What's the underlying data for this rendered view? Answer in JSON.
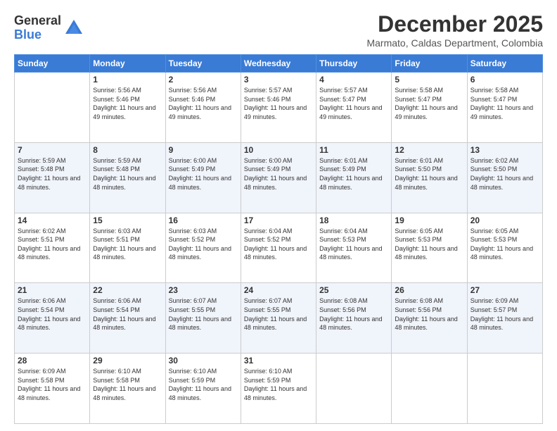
{
  "logo": {
    "general": "General",
    "blue": "Blue"
  },
  "title": "December 2025",
  "subtitle": "Marmato, Caldas Department, Colombia",
  "days_of_week": [
    "Sunday",
    "Monday",
    "Tuesday",
    "Wednesday",
    "Thursday",
    "Friday",
    "Saturday"
  ],
  "weeks": [
    [
      {
        "day": "",
        "sunrise": "",
        "sunset": "",
        "daylight": "",
        "empty": true
      },
      {
        "day": "1",
        "sunrise": "Sunrise: 5:56 AM",
        "sunset": "Sunset: 5:46 PM",
        "daylight": "Daylight: 11 hours and 49 minutes."
      },
      {
        "day": "2",
        "sunrise": "Sunrise: 5:56 AM",
        "sunset": "Sunset: 5:46 PM",
        "daylight": "Daylight: 11 hours and 49 minutes."
      },
      {
        "day": "3",
        "sunrise": "Sunrise: 5:57 AM",
        "sunset": "Sunset: 5:46 PM",
        "daylight": "Daylight: 11 hours and 49 minutes."
      },
      {
        "day": "4",
        "sunrise": "Sunrise: 5:57 AM",
        "sunset": "Sunset: 5:47 PM",
        "daylight": "Daylight: 11 hours and 49 minutes."
      },
      {
        "day": "5",
        "sunrise": "Sunrise: 5:58 AM",
        "sunset": "Sunset: 5:47 PM",
        "daylight": "Daylight: 11 hours and 49 minutes."
      },
      {
        "day": "6",
        "sunrise": "Sunrise: 5:58 AM",
        "sunset": "Sunset: 5:47 PM",
        "daylight": "Daylight: 11 hours and 49 minutes."
      }
    ],
    [
      {
        "day": "7",
        "sunrise": "Sunrise: 5:59 AM",
        "sunset": "Sunset: 5:48 PM",
        "daylight": "Daylight: 11 hours and 48 minutes."
      },
      {
        "day": "8",
        "sunrise": "Sunrise: 5:59 AM",
        "sunset": "Sunset: 5:48 PM",
        "daylight": "Daylight: 11 hours and 48 minutes."
      },
      {
        "day": "9",
        "sunrise": "Sunrise: 6:00 AM",
        "sunset": "Sunset: 5:49 PM",
        "daylight": "Daylight: 11 hours and 48 minutes."
      },
      {
        "day": "10",
        "sunrise": "Sunrise: 6:00 AM",
        "sunset": "Sunset: 5:49 PM",
        "daylight": "Daylight: 11 hours and 48 minutes."
      },
      {
        "day": "11",
        "sunrise": "Sunrise: 6:01 AM",
        "sunset": "Sunset: 5:49 PM",
        "daylight": "Daylight: 11 hours and 48 minutes."
      },
      {
        "day": "12",
        "sunrise": "Sunrise: 6:01 AM",
        "sunset": "Sunset: 5:50 PM",
        "daylight": "Daylight: 11 hours and 48 minutes."
      },
      {
        "day": "13",
        "sunrise": "Sunrise: 6:02 AM",
        "sunset": "Sunset: 5:50 PM",
        "daylight": "Daylight: 11 hours and 48 minutes."
      }
    ],
    [
      {
        "day": "14",
        "sunrise": "Sunrise: 6:02 AM",
        "sunset": "Sunset: 5:51 PM",
        "daylight": "Daylight: 11 hours and 48 minutes."
      },
      {
        "day": "15",
        "sunrise": "Sunrise: 6:03 AM",
        "sunset": "Sunset: 5:51 PM",
        "daylight": "Daylight: 11 hours and 48 minutes."
      },
      {
        "day": "16",
        "sunrise": "Sunrise: 6:03 AM",
        "sunset": "Sunset: 5:52 PM",
        "daylight": "Daylight: 11 hours and 48 minutes."
      },
      {
        "day": "17",
        "sunrise": "Sunrise: 6:04 AM",
        "sunset": "Sunset: 5:52 PM",
        "daylight": "Daylight: 11 hours and 48 minutes."
      },
      {
        "day": "18",
        "sunrise": "Sunrise: 6:04 AM",
        "sunset": "Sunset: 5:53 PM",
        "daylight": "Daylight: 11 hours and 48 minutes."
      },
      {
        "day": "19",
        "sunrise": "Sunrise: 6:05 AM",
        "sunset": "Sunset: 5:53 PM",
        "daylight": "Daylight: 11 hours and 48 minutes."
      },
      {
        "day": "20",
        "sunrise": "Sunrise: 6:05 AM",
        "sunset": "Sunset: 5:53 PM",
        "daylight": "Daylight: 11 hours and 48 minutes."
      }
    ],
    [
      {
        "day": "21",
        "sunrise": "Sunrise: 6:06 AM",
        "sunset": "Sunset: 5:54 PM",
        "daylight": "Daylight: 11 hours and 48 minutes."
      },
      {
        "day": "22",
        "sunrise": "Sunrise: 6:06 AM",
        "sunset": "Sunset: 5:54 PM",
        "daylight": "Daylight: 11 hours and 48 minutes."
      },
      {
        "day": "23",
        "sunrise": "Sunrise: 6:07 AM",
        "sunset": "Sunset: 5:55 PM",
        "daylight": "Daylight: 11 hours and 48 minutes."
      },
      {
        "day": "24",
        "sunrise": "Sunrise: 6:07 AM",
        "sunset": "Sunset: 5:55 PM",
        "daylight": "Daylight: 11 hours and 48 minutes."
      },
      {
        "day": "25",
        "sunrise": "Sunrise: 6:08 AM",
        "sunset": "Sunset: 5:56 PM",
        "daylight": "Daylight: 11 hours and 48 minutes."
      },
      {
        "day": "26",
        "sunrise": "Sunrise: 6:08 AM",
        "sunset": "Sunset: 5:56 PM",
        "daylight": "Daylight: 11 hours and 48 minutes."
      },
      {
        "day": "27",
        "sunrise": "Sunrise: 6:09 AM",
        "sunset": "Sunset: 5:57 PM",
        "daylight": "Daylight: 11 hours and 48 minutes."
      }
    ],
    [
      {
        "day": "28",
        "sunrise": "Sunrise: 6:09 AM",
        "sunset": "Sunset: 5:58 PM",
        "daylight": "Daylight: 11 hours and 48 minutes."
      },
      {
        "day": "29",
        "sunrise": "Sunrise: 6:10 AM",
        "sunset": "Sunset: 5:58 PM",
        "daylight": "Daylight: 11 hours and 48 minutes."
      },
      {
        "day": "30",
        "sunrise": "Sunrise: 6:10 AM",
        "sunset": "Sunset: 5:59 PM",
        "daylight": "Daylight: 11 hours and 48 minutes."
      },
      {
        "day": "31",
        "sunrise": "Sunrise: 6:10 AM",
        "sunset": "Sunset: 5:59 PM",
        "daylight": "Daylight: 11 hours and 48 minutes."
      },
      {
        "day": "",
        "sunrise": "",
        "sunset": "",
        "daylight": "",
        "empty": true
      },
      {
        "day": "",
        "sunrise": "",
        "sunset": "",
        "daylight": "",
        "empty": true
      },
      {
        "day": "",
        "sunrise": "",
        "sunset": "",
        "daylight": "",
        "empty": true
      }
    ]
  ]
}
